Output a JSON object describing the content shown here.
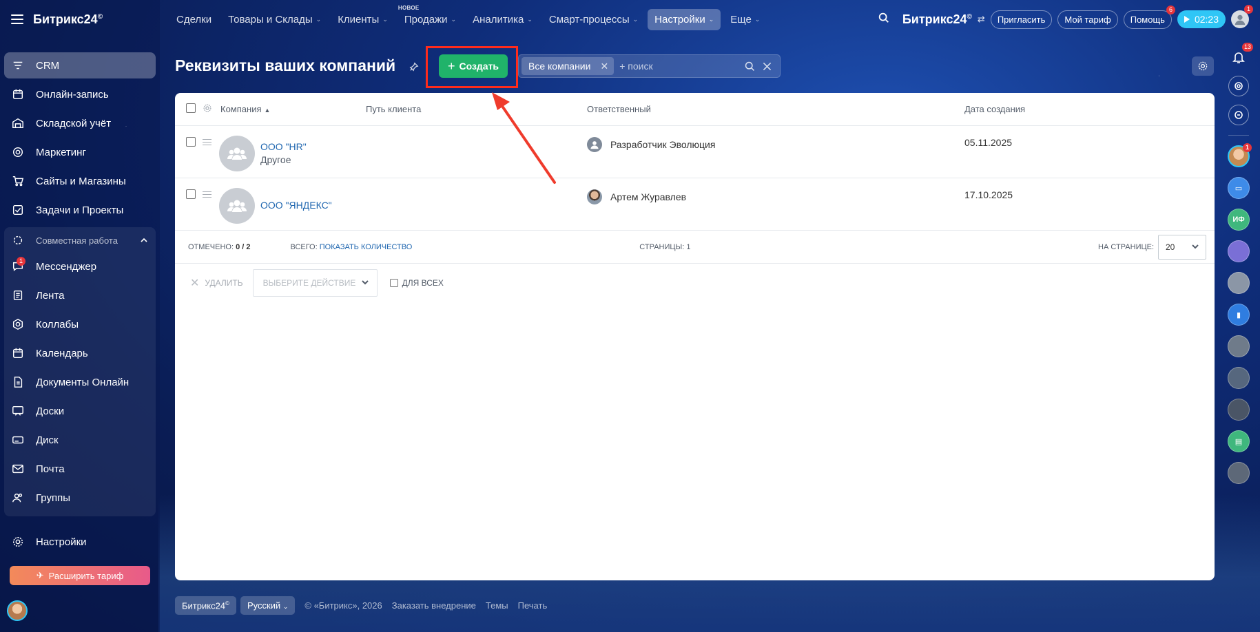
{
  "sidebar": {
    "logo": "Битрикс24",
    "logo_mark": "©",
    "items": [
      {
        "label": "CRM",
        "icon": "funnel-icon"
      },
      {
        "label": "Онлайн-запись",
        "icon": "calendar-booking-icon"
      },
      {
        "label": "Складской учёт",
        "icon": "warehouse-icon"
      },
      {
        "label": "Маркетинг",
        "icon": "target-icon"
      },
      {
        "label": "Сайты и Магазины",
        "icon": "cart-icon"
      },
      {
        "label": "Задачи и Проекты",
        "icon": "checkbox-icon"
      }
    ],
    "group_title": "Совместная работа",
    "group_items": [
      {
        "label": "Мессенджер",
        "icon": "chat-icon",
        "badge": "1"
      },
      {
        "label": "Лента",
        "icon": "feed-icon"
      },
      {
        "label": "Коллабы",
        "icon": "collab-icon"
      },
      {
        "label": "Календарь",
        "icon": "calendar-icon"
      },
      {
        "label": "Документы Онлайн",
        "icon": "document-icon"
      },
      {
        "label": "Доски",
        "icon": "board-icon"
      },
      {
        "label": "Диск",
        "icon": "disk-icon"
      },
      {
        "label": "Почта",
        "icon": "mail-icon"
      },
      {
        "label": "Группы",
        "icon": "groups-icon"
      }
    ],
    "settings": "Настройки",
    "upgrade": "Расширить тариф"
  },
  "topnav": {
    "items": [
      {
        "label": "Сделки",
        "caret": false
      },
      {
        "label": "Товары и Склады",
        "caret": true
      },
      {
        "label": "Клиенты",
        "caret": true
      },
      {
        "label": "Продажи",
        "caret": true,
        "new": "НОВОЕ"
      },
      {
        "label": "Аналитика",
        "caret": true
      },
      {
        "label": "Смарт-процессы",
        "caret": true
      },
      {
        "label": "Настройки",
        "caret": true,
        "active": true
      },
      {
        "label": "Еще",
        "caret": true
      }
    ],
    "brand": "Битрикс24",
    "brand_mark": "©",
    "invite": "Пригласить",
    "tariff": "Мой тариф",
    "help": "Помощь",
    "help_badge": "6",
    "timer": "02:23",
    "avatar_badge": "1"
  },
  "page": {
    "title": "Реквизиты ваших компаний",
    "create_label": "Создать",
    "filter_tag": "Все компании",
    "search_placeholder": "+ поиск"
  },
  "table": {
    "headers": {
      "company": "Компания",
      "path": "Путь клиента",
      "responsible": "Ответственный",
      "date": "Дата создания"
    },
    "rows": [
      {
        "name": "ООО \"HR\"",
        "type": "Другое",
        "responsible": "Разработчик Эволюция",
        "date": "05.11.2025"
      },
      {
        "name": "ООО \"ЯНДЕКС\"",
        "type": "",
        "responsible": "Артем Журавлев",
        "date": "17.10.2025"
      }
    ],
    "selected_label": "ОТМЕЧЕНО:",
    "selected_value": "0 / 2",
    "total_label": "ВСЕГО:",
    "total_link": "ПОКАЗАТЬ КОЛИЧЕСТВО",
    "pages_label": "СТРАНИЦЫ:",
    "pages_value": "1",
    "per_page_label": "НА СТРАНИЦЕ:",
    "per_page_value": "20",
    "delete_label": "УДАЛИТЬ",
    "action_placeholder": "ВЫБЕРИТЕ ДЕЙСТВИЕ",
    "for_all_label": "ДЛЯ ВСЕХ"
  },
  "footer": {
    "brand": "Битрикс24",
    "brand_mark": "©",
    "language": "Русский",
    "copyright": "© «Битрикс», 2026",
    "order": "Заказать внедрение",
    "themes": "Темы",
    "print": "Печать"
  },
  "rail": {
    "notifications_badge": "13",
    "avatar_badge": "1",
    "initials": "ИФ"
  },
  "colors": {
    "accent_green": "#20b36a",
    "highlight_red": "#ff2b1c",
    "link_blue": "#2067b0",
    "timer_blue": "#2fc6f6"
  }
}
